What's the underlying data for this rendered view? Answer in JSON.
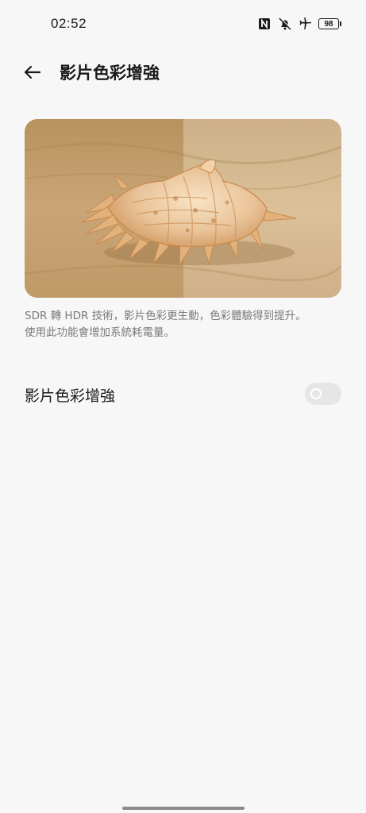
{
  "status_bar": {
    "time": "02:52",
    "battery_level": "98",
    "icons": [
      "nfc-icon",
      "bell-muted-icon",
      "airplane-icon",
      "battery-icon"
    ]
  },
  "header": {
    "back_icon": "back-arrow-icon",
    "title": "影片色彩增強"
  },
  "preview": {
    "subject": "seashell-on-sand",
    "colors": {
      "sand_left": "#c9a577",
      "sand_right": "#d9bd94",
      "shell": "#e9c9a0"
    }
  },
  "description": {
    "line1": "SDR 轉 HDR 技術，影片色彩更生動，色彩體驗得到提升。",
    "line2": "使用此功能會增加系統耗電量。"
  },
  "setting": {
    "label": "影片色彩增強",
    "toggle_on": false
  },
  "colors": {
    "background": "#f7f7f7",
    "text_primary": "#1a1a1a",
    "text_secondary": "#7a7a7a",
    "toggle_off": "#e6e6e6"
  }
}
